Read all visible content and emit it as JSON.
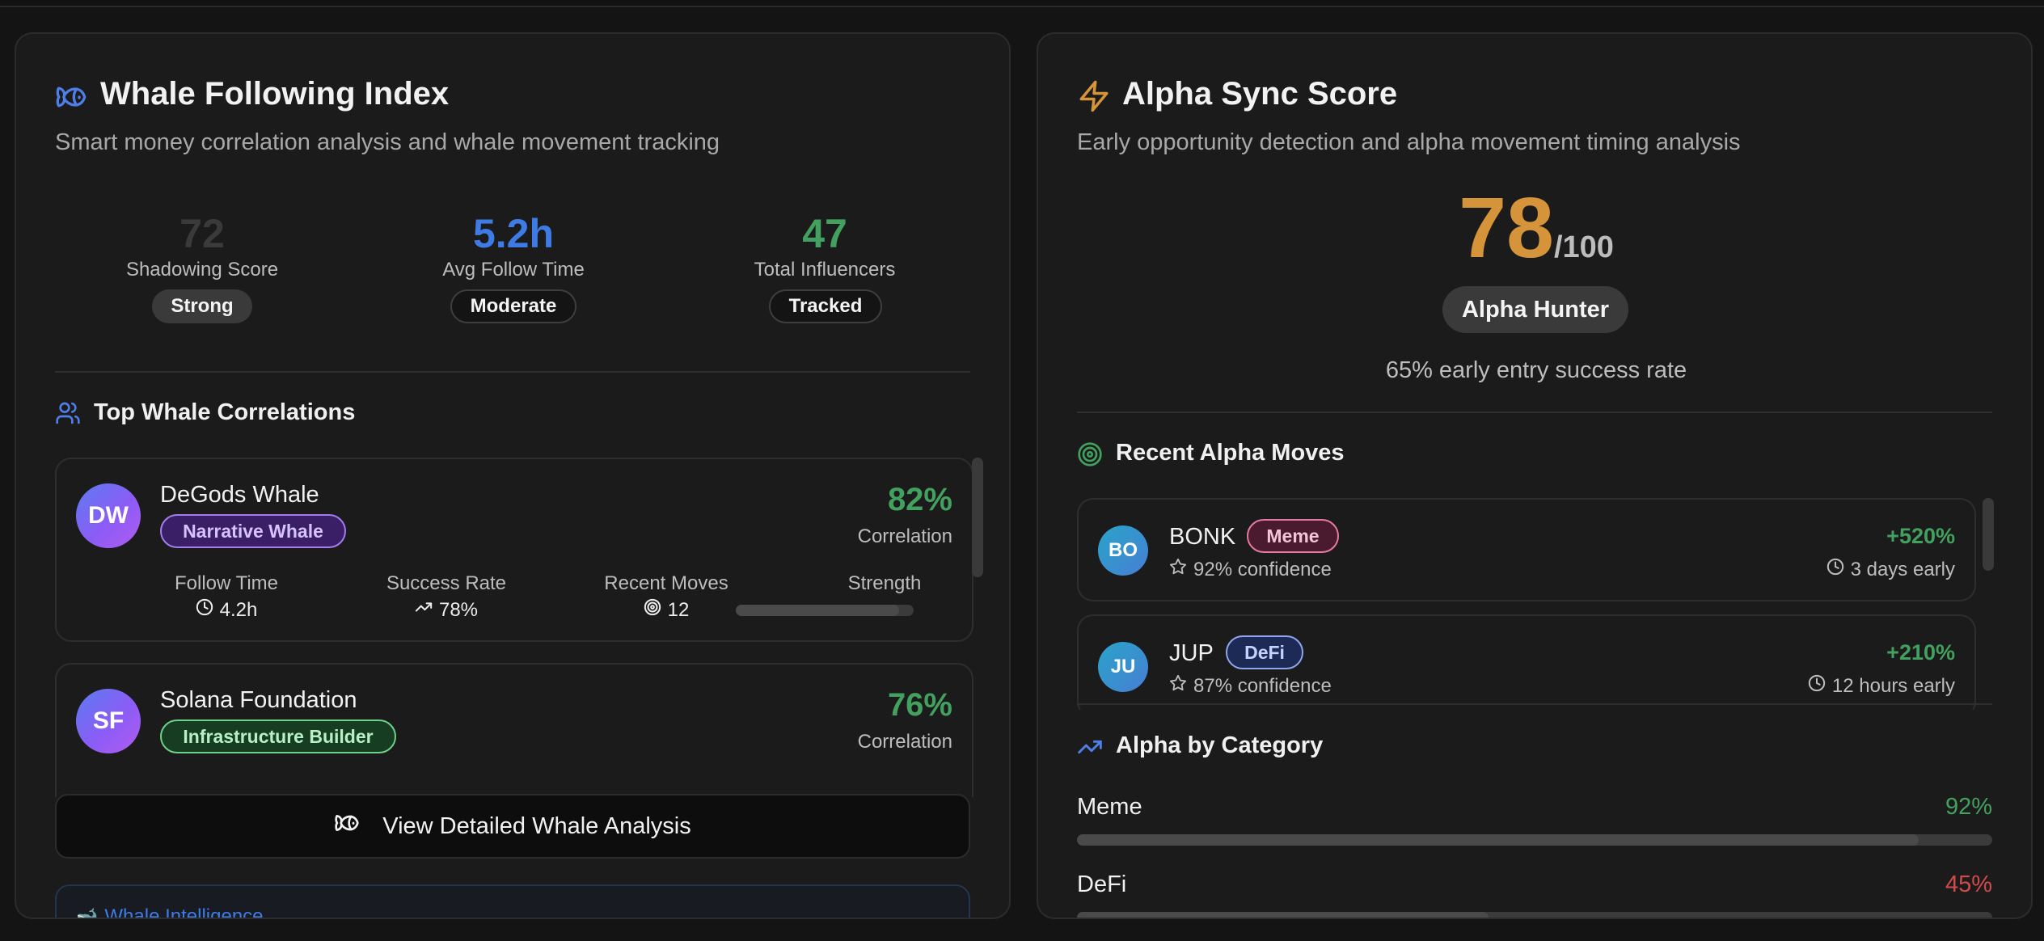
{
  "whale": {
    "title": "Whale Following Index",
    "subtitle": "Smart money correlation analysis and whale movement tracking",
    "metrics": [
      {
        "value": "72",
        "label": "Shadowing Score",
        "badge": "Strong",
        "color": "#3a3a3a"
      },
      {
        "value": "5.2h",
        "label": "Avg Follow Time",
        "badge": "Moderate",
        "color": "#3f7be6"
      },
      {
        "value": "47",
        "label": "Total Influencers",
        "badge": "Tracked",
        "color": "#43a15f"
      }
    ],
    "section_title": "Top Whale Correlations",
    "correlations": [
      {
        "initials": "DW",
        "name": "DeGods Whale",
        "tag": "Narrative Whale",
        "percent": "82%",
        "percent_label": "Correlation",
        "stats": {
          "follow_time_label": "Follow Time",
          "follow_time": "4.2h",
          "success_rate_label": "Success Rate",
          "success_rate": "78%",
          "recent_moves_label": "Recent Moves",
          "recent_moves": "12",
          "strength_label": "Strength",
          "strength_value": 0.92
        }
      },
      {
        "initials": "SF",
        "name": "Solana Foundation",
        "tag": "Infrastructure Builder",
        "percent": "76%",
        "percent_label": "Correlation"
      }
    ],
    "button_label": "View Detailed Whale Analysis",
    "intel_title": "Whale Intelligence"
  },
  "alpha": {
    "title": "Alpha Sync Score",
    "subtitle": "Early opportunity detection and alpha movement timing analysis",
    "score": "78",
    "score_denominator": "/100",
    "rank_badge": "Alpha Hunter",
    "success_text": "65% early entry success rate",
    "moves_title": "Recent Alpha Moves",
    "moves": [
      {
        "initials": "BO",
        "token": "BONK",
        "tag": "Meme",
        "confidence": "92% confidence",
        "gain": "+520%",
        "timing": "3 days early"
      },
      {
        "initials": "JU",
        "token": "JUP",
        "tag": "DeFi",
        "confidence": "87% confidence",
        "gain": "+210%",
        "timing": "12 hours early"
      }
    ],
    "category_title": "Alpha by Category",
    "categories": [
      {
        "name": "Meme",
        "percent": "92%",
        "value": 0.92,
        "color": "#43a15f"
      },
      {
        "name": "DeFi",
        "percent": "45%",
        "value": 0.45,
        "color": "#d24b4b"
      }
    ]
  },
  "icons": {
    "whale_title": "fish-icon",
    "alpha_title": "lightning-icon",
    "correlations": "users-icon",
    "moves": "target-icon",
    "category": "trending-up-icon"
  }
}
